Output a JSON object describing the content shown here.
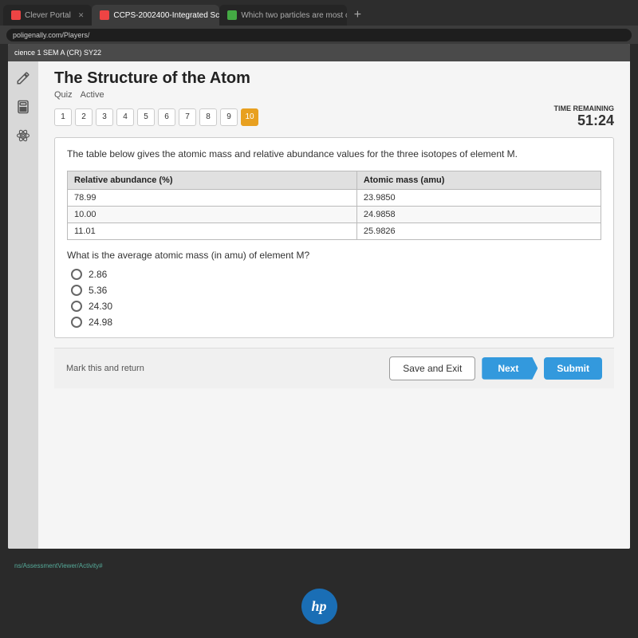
{
  "browser": {
    "tabs": [
      {
        "label": "Clever Portal",
        "active": false,
        "favicon_color": "#e44"
      },
      {
        "label": "CCPS-2002400-Integrated Scie...",
        "active": true,
        "favicon_color": "#e44"
      },
      {
        "label": "Which two particles are most cl...",
        "active": false,
        "favicon_color": "#4a4"
      }
    ],
    "address": "poligenally.com/Players/"
  },
  "top_bar": {
    "text": "cience 1 SEM A (CR) SY22"
  },
  "quiz": {
    "title": "The Structure of the Atom",
    "meta_quiz": "Quiz",
    "meta_status": "Active",
    "time_label": "TIME REMAINING",
    "time_value": "51:24",
    "questions": [
      {
        "number": "1",
        "current": false
      },
      {
        "number": "2",
        "current": false
      },
      {
        "number": "3",
        "current": false
      },
      {
        "number": "4",
        "current": false
      },
      {
        "number": "5",
        "current": false
      },
      {
        "number": "6",
        "current": false
      },
      {
        "number": "7",
        "current": false
      },
      {
        "number": "8",
        "current": false
      },
      {
        "number": "9",
        "current": false
      },
      {
        "number": "10",
        "current": true
      }
    ]
  },
  "question": {
    "intro": "The table below gives the atomic mass and relative abundance values for the three isotopes of element M.",
    "table": {
      "col1_header": "Relative abundance (%)",
      "col2_header": "Atomic mass (amu)",
      "rows": [
        {
          "col1": "78.99",
          "col2": "23.9850"
        },
        {
          "col1": "10.00",
          "col2": "24.9858"
        },
        {
          "col1": "11.01",
          "col2": "25.9826"
        }
      ]
    },
    "prompt": "What is the average atomic mass (in amu) of element M?",
    "choices": [
      {
        "label": "2.86",
        "selected": false
      },
      {
        "label": "5.36",
        "selected": false
      },
      {
        "label": "24.30",
        "selected": false
      },
      {
        "label": "24.98",
        "selected": false
      }
    ]
  },
  "actions": {
    "mark_return": "Mark this and return",
    "save_exit": "Save and Exit",
    "next": "Next",
    "submit": "Submit"
  },
  "bottom": {
    "url": "ns/AssessmentViewer/Activity#"
  }
}
